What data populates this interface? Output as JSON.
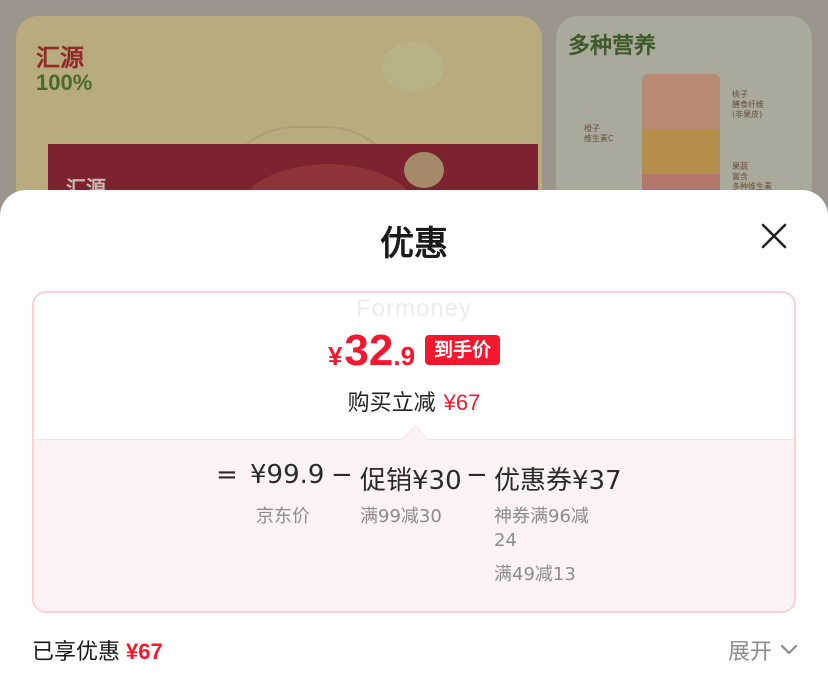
{
  "background": {
    "brand_logo": "汇源",
    "brand_percent": "100%",
    "banner_logo": "汇源",
    "nutrition_title": "多种营养",
    "labels": [
      "桃子\n膳食纤维\n(非果皮)",
      "橙子\n维生素C",
      "果蔬\n富含\n多种维生素"
    ]
  },
  "sheet": {
    "title": "优惠",
    "watermark": "Formoney",
    "price": {
      "currency": "¥",
      "integer": "32",
      "decimal": ".9",
      "tag": "到手价"
    },
    "savings": {
      "label": "购买立减",
      "amount": "¥67"
    },
    "breakdown": {
      "equals": "=",
      "minus": "−",
      "base_price": "¥99.9",
      "base_label": "京东价",
      "promo_price": "促销¥30",
      "promo_desc": "满99减30",
      "coupon_price": "优惠券¥37",
      "coupon_desc_1": "神券满96减",
      "coupon_desc_2": "24",
      "coupon_desc_3": "满49减13"
    },
    "footer": {
      "enjoyed_label": "已享优惠",
      "enjoyed_amount": "¥67",
      "expand_label": "展开"
    }
  },
  "colors": {
    "accent_red": "#f5172e",
    "box_border": "#fbd1d6",
    "detail_bg": "#fdf3f4"
  },
  "icons": [
    "close-icon",
    "chevron-down-icon"
  ]
}
